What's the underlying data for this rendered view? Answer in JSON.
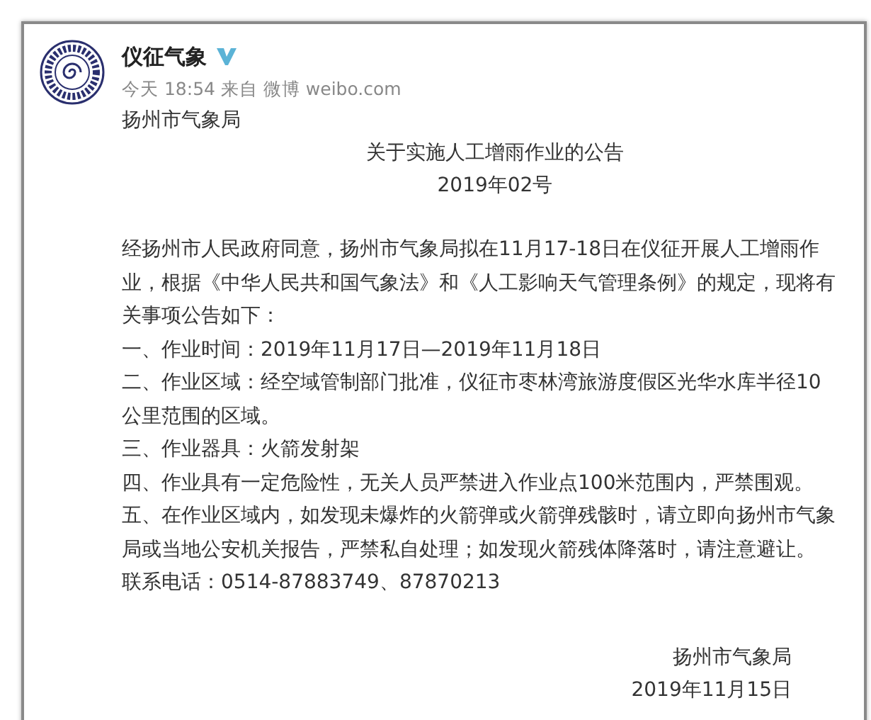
{
  "post": {
    "author": "仪征气象",
    "verified": true,
    "meta": "今天 18:54 来自 微博 weibo.com",
    "issuer": "扬州市气象局",
    "title": "关于实施人工增雨作业的公告",
    "number": "2019年02号",
    "paragraphs": [
      "经扬州市人民政府同意，扬州市气象局拟在11月17-18日在仪征开展人工增雨作业，根据《中华人民共和国气象法》和《人工影响天气管理条例》的规定，现将有关事项公告如下：",
      "一、作业时间：2019年11月17日—2019年11月18日",
      "二、作业区域：经空域管制部门批准，仪征市枣林湾旅游度假区光华水库半径10公里范围的区域。",
      "三、作业器具：火箭发射架",
      "四、作业具有一定危险性，无关人员严禁进入作业点100米范围内，严禁围观。",
      "五、在作业区域内，如发现未爆炸的火箭弹或火箭弹残骸时，请立即向扬州市气象局或当地公安机关报告，严禁私自处理；如发现火箭残体降落时，请注意避让。",
      "联系电话：0514-87883749、87870213"
    ],
    "signature": [
      "扬州市气象局",
      "2019年11月15日"
    ]
  }
}
